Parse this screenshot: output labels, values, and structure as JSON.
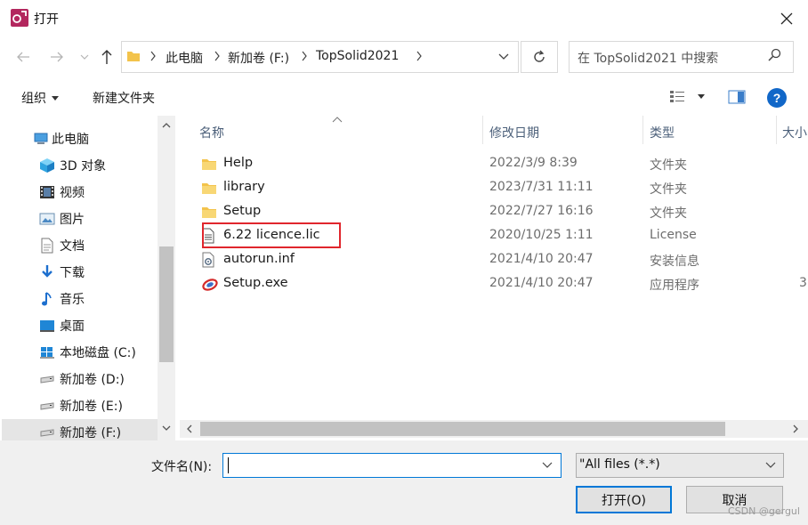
{
  "window": {
    "title": "打开",
    "accent": "#0078d7",
    "app_icon_color": "#b3275e"
  },
  "address": {
    "crumbs": [
      "此电脑",
      "新加卷 (F:)",
      "TopSolid2021"
    ]
  },
  "search": {
    "placeholder": "在 TopSolid2021 中搜索"
  },
  "toolbar": {
    "organize": "组织",
    "new_folder": "新建文件夹",
    "help": "?"
  },
  "nav": {
    "items": [
      {
        "label": "此电脑",
        "icon": "computer-icon"
      },
      {
        "label": "3D 对象",
        "icon": "3d-objects-icon"
      },
      {
        "label": "视频",
        "icon": "video-icon"
      },
      {
        "label": "图片",
        "icon": "pictures-icon"
      },
      {
        "label": "文档",
        "icon": "documents-icon"
      },
      {
        "label": "下载",
        "icon": "download-icon"
      },
      {
        "label": "音乐",
        "icon": "music-icon"
      },
      {
        "label": "桌面",
        "icon": "desktop-icon"
      },
      {
        "label": "本地磁盘 (C:)",
        "icon": "windows-drive-icon"
      },
      {
        "label": "新加卷 (D:)",
        "icon": "drive-icon"
      },
      {
        "label": "新加卷 (E:)",
        "icon": "drive-icon"
      },
      {
        "label": "新加卷 (F:)",
        "icon": "drive-icon"
      }
    ]
  },
  "columns": {
    "name": "名称",
    "modified": "修改日期",
    "type": "类型",
    "size": "大小"
  },
  "files": [
    {
      "name": "Help",
      "date": "2022/3/9 8:39",
      "type": "文件夹",
      "size": "",
      "icon": "folder-icon"
    },
    {
      "name": "library",
      "date": "2023/7/31 11:11",
      "type": "文件夹",
      "size": "",
      "icon": "folder-icon"
    },
    {
      "name": "Setup",
      "date": "2022/7/27 16:16",
      "type": "文件夹",
      "size": "",
      "icon": "folder-icon"
    },
    {
      "name": "6.22 licence.lic",
      "date": "2020/10/25 1:11",
      "type": "License",
      "size": "",
      "icon": "text-file-icon"
    },
    {
      "name": "autorun.inf",
      "date": "2021/4/10 20:47",
      "type": "安装信息",
      "size": "",
      "icon": "setup-info-icon"
    },
    {
      "name": "Setup.exe",
      "date": "2021/4/10 20:47",
      "type": "应用程序",
      "size": "3",
      "icon": "exe-icon"
    }
  ],
  "bottom": {
    "filename_label": "文件名(N):",
    "filename_value": "",
    "filetype": "\"All files (*.*)",
    "open": "打开(O)",
    "cancel": "取消"
  },
  "watermark": "CSDN @gergul"
}
